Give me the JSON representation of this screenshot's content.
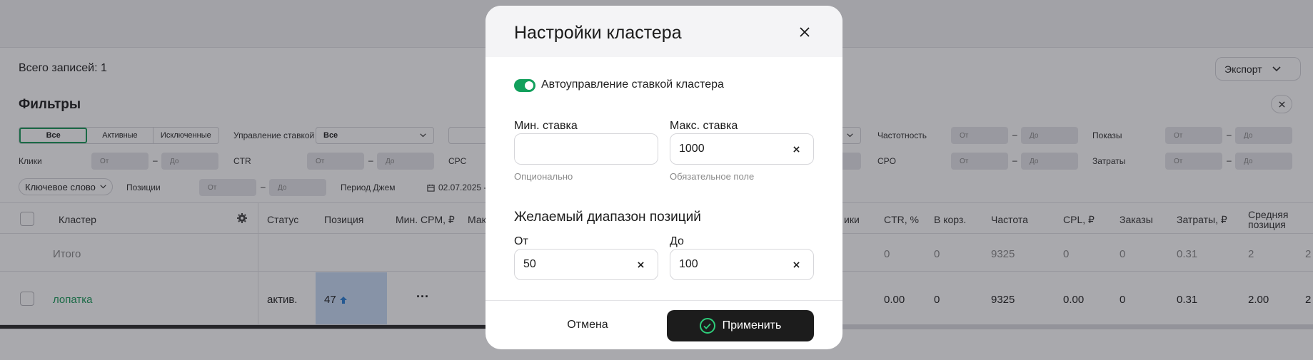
{
  "background": {
    "total_records": "Всего записей: 1",
    "export_label": "Экспорт",
    "filters_title": "Фильтры",
    "segments": [
      "Все",
      "Активные",
      "Исключенные"
    ],
    "filter_labels": {
      "bid_control": "Управление ставкой",
      "bid_control_value": "Все",
      "frequency": "Частотность",
      "impressions": "Показы",
      "clicks": "Клики",
      "ctr": "CTR",
      "cpc": "CPC",
      "cpo": "CPO",
      "costs": "Затраты",
      "keyword": "Ключевое слово",
      "positions": "Позиции",
      "period": "Период Джем",
      "period_value": "02.07.2025 -"
    },
    "from_placeholder": "От",
    "to_placeholder": "До",
    "columns": {
      "cluster": "Кластер",
      "status": "Статус",
      "position": "Позиция",
      "min_cpm": "Мин. CPM, ₽",
      "max_partial": "Мак",
      "clicks_partial": "ики",
      "ctr": "CTR, %",
      "to_cart": "В корз.",
      "frequency": "Частота",
      "cpl": "CPL, ₽",
      "orders": "Заказы",
      "costs": "Затраты, ₽",
      "avg_position_1": "Средняя",
      "avg_position_2": "позиция"
    },
    "total_row": {
      "label": "Итого",
      "ctr": "0",
      "to_cart": "0",
      "frequency": "9325",
      "cpl": "0",
      "orders": "0",
      "costs": "0.31",
      "avg_position": "2",
      "last": "2"
    },
    "data_row": {
      "cluster": "лопатка",
      "status": "актив.",
      "position": "47",
      "ctr": "0.00",
      "to_cart": "0",
      "frequency": "9325",
      "cpl": "0.00",
      "orders": "0",
      "costs": "0.31",
      "avg_position": "2.00",
      "last": "2"
    }
  },
  "modal": {
    "title": "Настройки кластера",
    "auto_bid_label": "Автоуправление ставкой кластера",
    "auto_bid_enabled": true,
    "min_bid": {
      "label": "Мин. ставка",
      "value": "",
      "hint": "Опционально"
    },
    "max_bid": {
      "label": "Макс. ставка",
      "value": "1000",
      "hint": "Обязательное поле"
    },
    "range_title": "Желаемый диапазон позиций",
    "range_from": {
      "label": "От",
      "value": "50"
    },
    "range_to": {
      "label": "До",
      "value": "100"
    },
    "cancel_label": "Отмена",
    "apply_label": "Применить"
  },
  "colors": {
    "accent_green": "#12a05c",
    "apply_button": "#1c1c1c",
    "position_cell": "#c9dcf6",
    "link_green": "#1a9a5a"
  }
}
